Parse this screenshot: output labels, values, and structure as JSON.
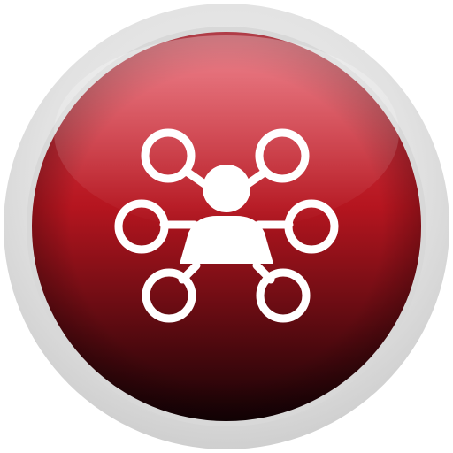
{
  "icon": {
    "name": "network-user-icon",
    "colors": {
      "bezel_light": "#f2f2f2",
      "bezel_mid": "#e2e2e2",
      "bezel_dark": "#cfcfcf",
      "disc_top": "#e8505e",
      "disc_mid": "#b5151f",
      "disc_bottom": "#150205",
      "glyph": "#ffffff"
    }
  }
}
